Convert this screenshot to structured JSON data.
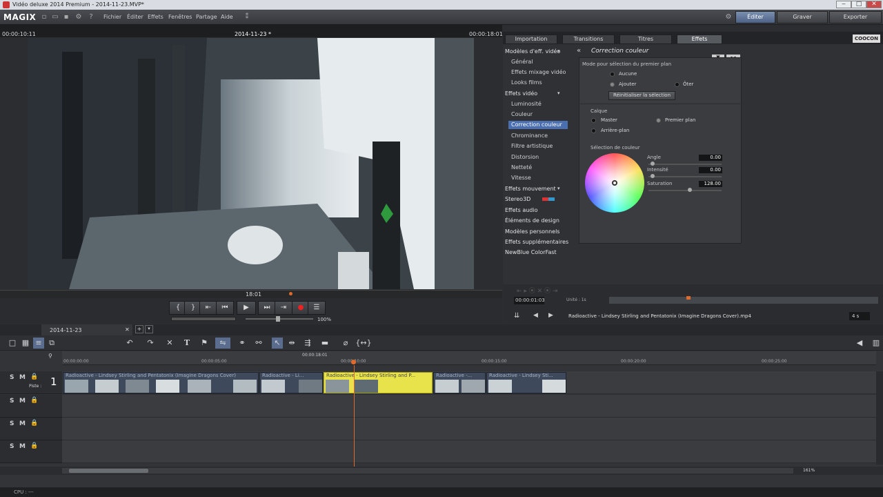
{
  "window": {
    "title": "Vidéo deluxe 2014 Premium - 2014-11-23.MVP*",
    "min": "‒",
    "max": "□",
    "close": "✕"
  },
  "menubar": {
    "logo": "MAGIX",
    "items": [
      "Fichier",
      "Éditer",
      "Effets",
      "Fenêtres",
      "Partage",
      "Aide"
    ],
    "modes": {
      "edit": "Éditer",
      "burn": "Graver",
      "export": "Exporter"
    }
  },
  "preview": {
    "time_left": "00:00:10:11",
    "date": "2014-11-23 *",
    "time_right": "00:00:18:01",
    "marker": "18:01",
    "zoom": "100%"
  },
  "tabs": [
    "Importation",
    "Transitions",
    "Titres",
    "Effets"
  ],
  "brand": "COOCON",
  "effects_tree": {
    "groups": [
      {
        "label": "Modèles d'eff. vidéo"
      },
      {
        "label": "Effets vidéo"
      },
      {
        "label": "Effets mouvement"
      },
      {
        "label": "Stereo3D"
      },
      {
        "label": "Effets audio"
      },
      {
        "label": "Éléments de design"
      },
      {
        "label": "Modèles personnels"
      },
      {
        "label": "Effets supplémentaires"
      },
      {
        "label": "NewBlue ColorFast"
      }
    ],
    "sub_a": [
      "Général",
      "Effets mixage vidéo",
      "Looks films"
    ],
    "sub_b": [
      "Luminosité",
      "Couleur",
      "Correction couleur",
      "Chrominance",
      "Filtre artistique",
      "Distorsion",
      "Netteté",
      "Vitesse"
    ]
  },
  "color_correction": {
    "title": "Correction couleur",
    "mode_label": "Mode pour sélection du premier plan",
    "none": "Aucune",
    "add": "Ajouter",
    "remove": "Ôter",
    "reset": "Réinitialiser la sélection",
    "layer_label": "Calque",
    "master": "Master",
    "foreground": "Premier plan",
    "background": "Arrière-plan",
    "color_selection": "Sélection de couleur",
    "angle_label": "Angle",
    "angle": "0.00",
    "intensity_label": "Intensité",
    "intensity": "0.00",
    "saturation_label": "Saturation",
    "saturation": "128.00",
    "saturation_level": 0.6
  },
  "panel_bottom": {
    "time": "00:00:01:03",
    "unit": "Unité : 1s",
    "filename": "Radioactive - Lindsey Stirling and Pentatonix (Imagine Dragons Cover).mp4",
    "duration": "4 s"
  },
  "timeline": {
    "project_tab": "2014-11-23",
    "ruler": [
      "00:00:00:00",
      "00:00:05:00",
      "00:00:10:00",
      "00:00:15:00",
      "00:00:20:00",
      "00:00:25:00"
    ],
    "cursor_time": "00:00:18:01",
    "track_num": "1",
    "piste": "Piste :",
    "clips": [
      {
        "label": "Radioactive - Lindsey Stirling and Pentatonix (Imagine Dragons Cover)"
      },
      {
        "label": "Radioactive - Li..."
      },
      {
        "label": "Radioactive - Lindsey Stirling and P..."
      },
      {
        "label": "Radioactive -..."
      },
      {
        "label": "Radioactive - Lindsey Sti..."
      }
    ],
    "zoom": "161%",
    "track_s": "S",
    "track_m": "M"
  },
  "status": {
    "cpu": "CPU : ---"
  }
}
